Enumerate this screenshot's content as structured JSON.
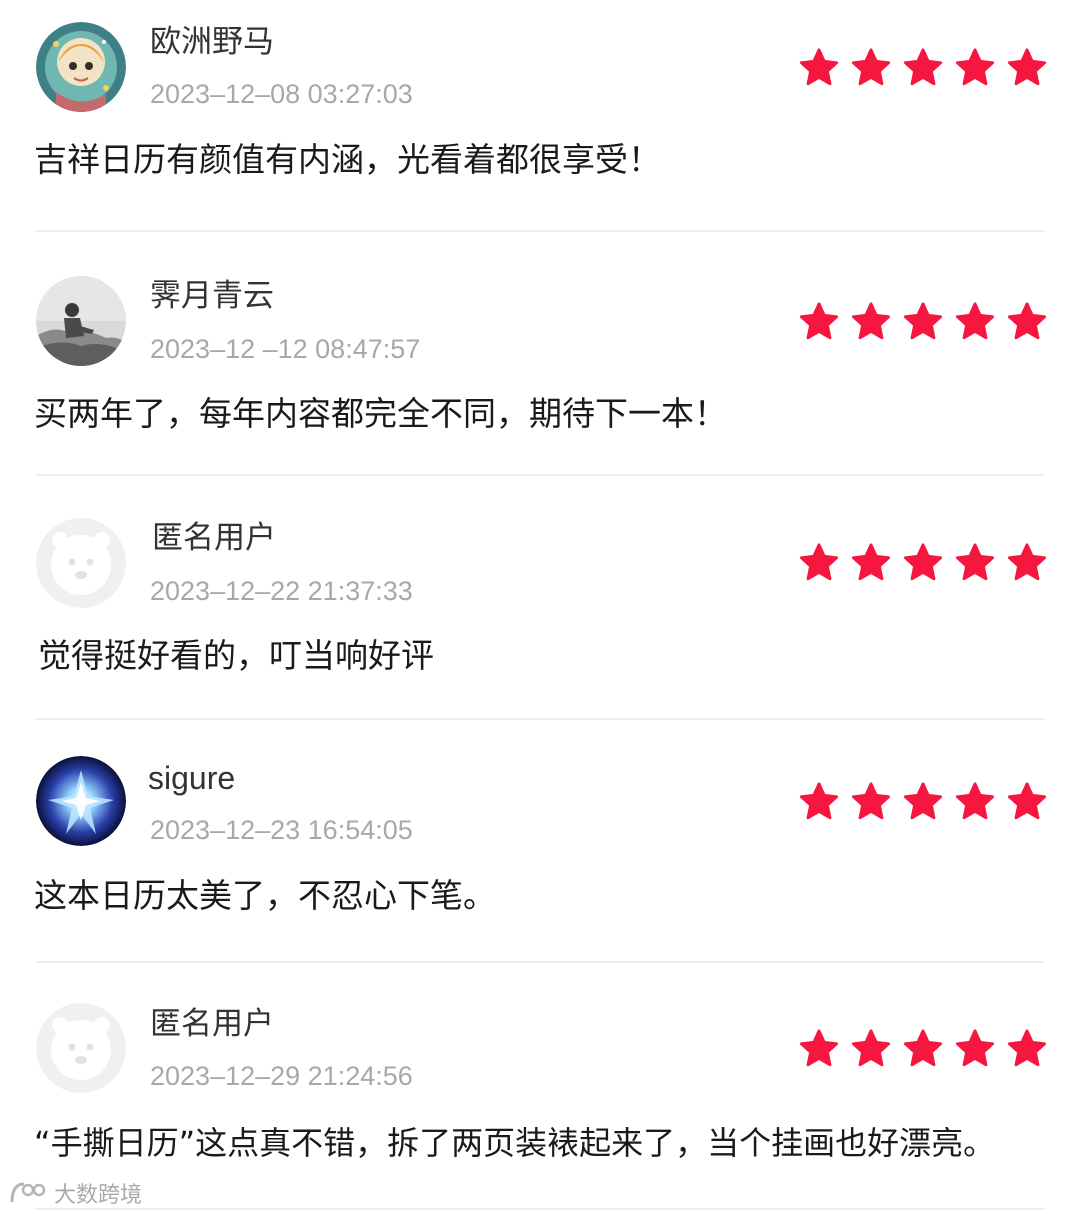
{
  "reviews": [
    {
      "username": "欧洲野马",
      "timestamp": "2023–12–08 03:27:03",
      "rating": 5,
      "comment": "吉祥日历有颜值有内涵，光看着都很享受！",
      "avatar_icon": "astronaut-avatar-icon"
    },
    {
      "username": "霁月青云",
      "timestamp": "2023–12 –12 08:47:57",
      "rating": 5,
      "comment": "买两年了，每年内容都完全不同，期待下一本！",
      "avatar_icon": "photo-avatar-icon"
    },
    {
      "username": "匿名用户",
      "timestamp": "2023–12–22 21:37:33",
      "rating": 5,
      "comment": "觉得挺好看的，叮当响好评",
      "avatar_icon": "default-avatar-icon"
    },
    {
      "username": "sigure",
      "timestamp": "2023–12–23 16:54:05",
      "rating": 5,
      "comment": "这本日历太美了，不忍心下笔。",
      "avatar_icon": "crystal-avatar-icon"
    },
    {
      "username": "匿名用户",
      "timestamp": "2023–12–29 21:24:56",
      "rating": 5,
      "comment": "“手撕日历”这点真不错，拆了两页装裱起来了，当个挂画也好漂亮。",
      "avatar_icon": "default-avatar-icon"
    }
  ],
  "watermark": {
    "text": "大数跨境"
  },
  "colors": {
    "star": "#f5173f",
    "username": "#333333",
    "timestamp": "#a8a8a8",
    "comment": "#1a1a1a",
    "divider": "#ececec"
  }
}
